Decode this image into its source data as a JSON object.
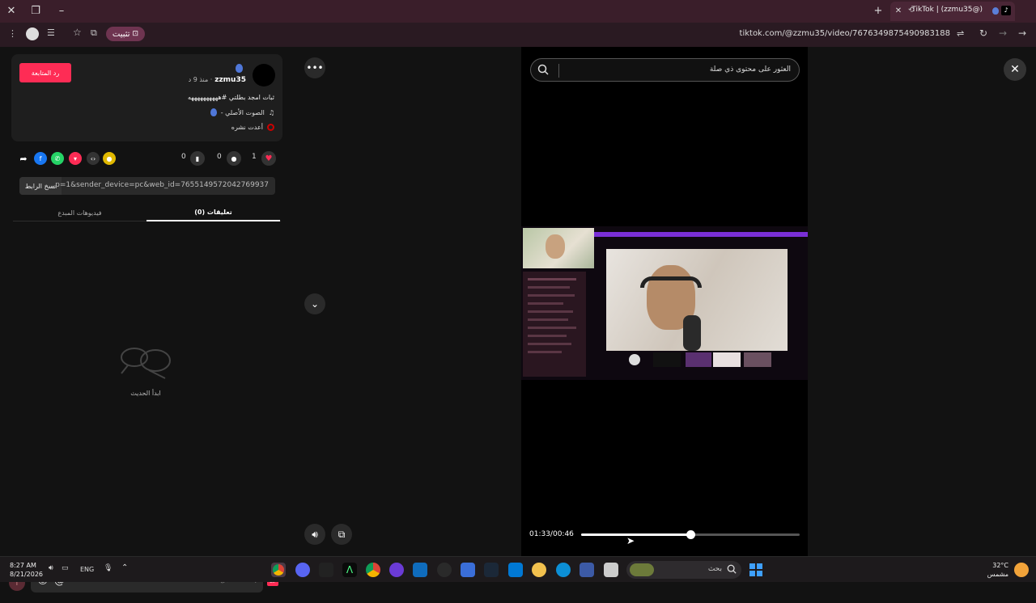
{
  "browser": {
    "tab_title": "TikTok | (zzmu35@)",
    "install_label": "تثبيت",
    "url": "tiktok.com/@zzmu35/video/7676349875490983188"
  },
  "author": {
    "follow_label": "رد المتابعة",
    "username": "zzmu35",
    "time_ago": "· منذ 9 د",
    "caption": "ثبات امجد بطلتي #ههههههههههه",
    "sound": "الصوت الأصلي -",
    "reposted": "أعدت نشره"
  },
  "actions": {
    "likes": "1",
    "comments": "0",
    "saves": "0",
    "shares": "0"
  },
  "share_link": {
    "copy_label": "نسخ الرابط",
    "text": "...p=1&sender_device=pc&web_id=7655149572042769937"
  },
  "tabs": {
    "comments": "(0) تعليقات",
    "creator_videos": "فيديوهات المبدع"
  },
  "empty": {
    "label": "ابدأ الحديث"
  },
  "comment": {
    "placeholder": "إضافة تعليق...",
    "gif": "GIF"
  },
  "video": {
    "search_placeholder": "العثور على محتوى ذي صلة",
    "time": "01:33/00:46",
    "progress": 0.5
  },
  "taskbar": {
    "time": "8:27 AM",
    "date": "8/21/2026",
    "lang": "ENG",
    "search_label": "بحث",
    "temp": "32°C",
    "weather": "مشمس"
  }
}
